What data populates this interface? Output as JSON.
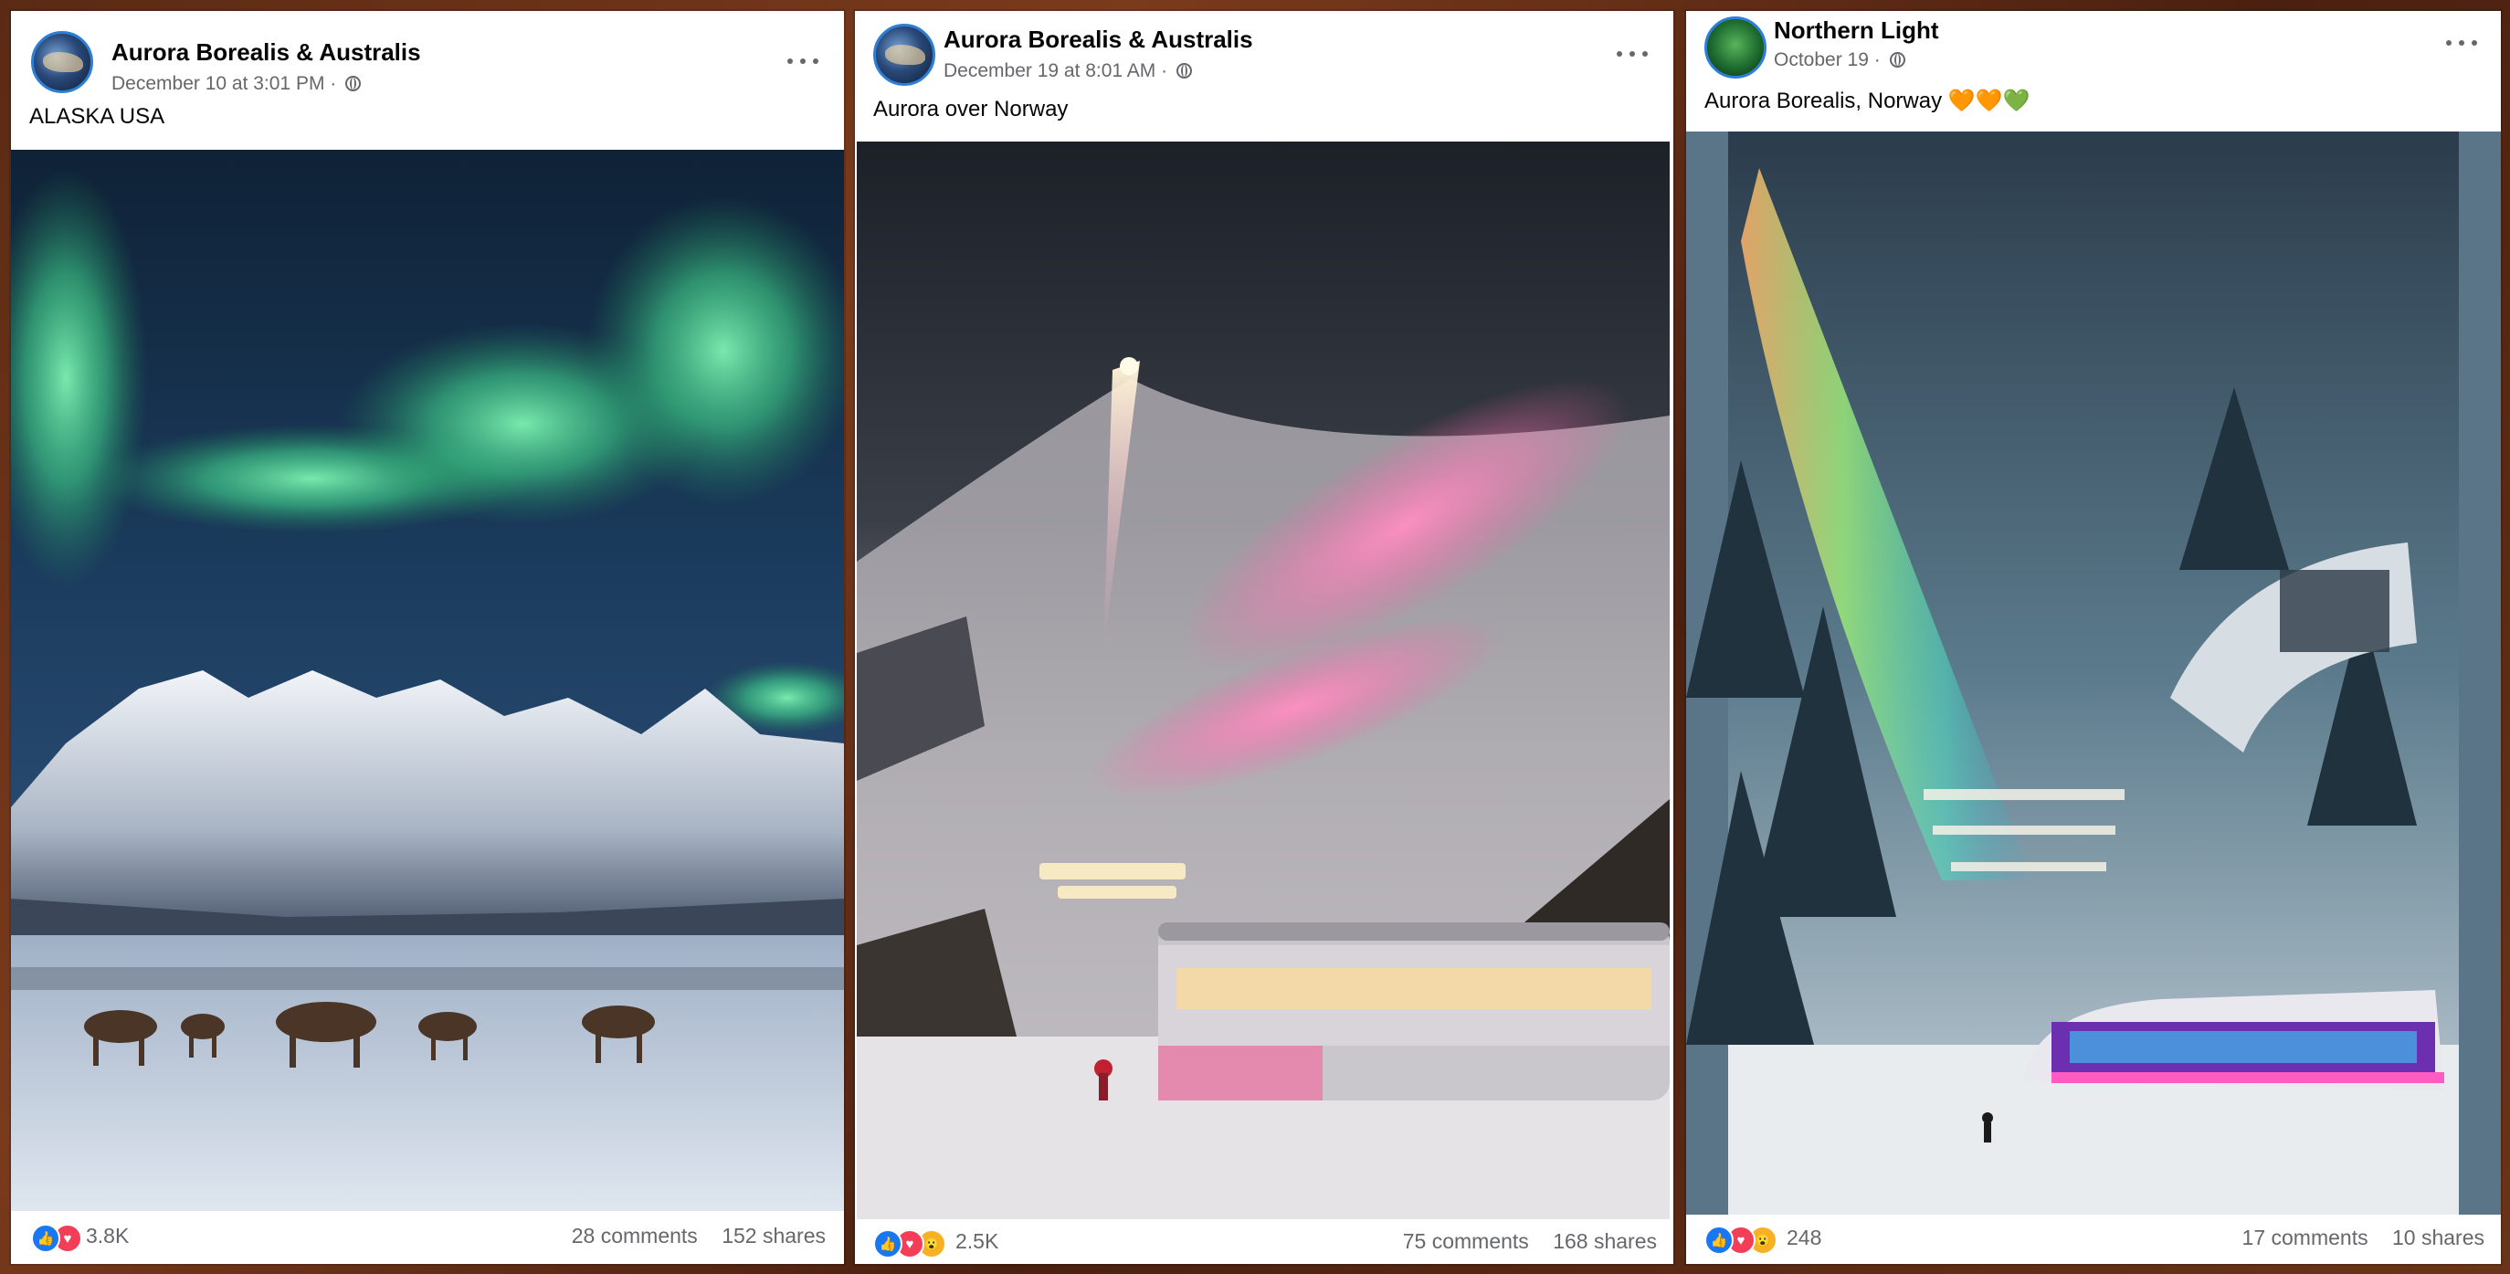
{
  "posts": [
    {
      "author": "Aurora Borealis & Australis",
      "timestamp": "December 10 at 3:01 PM",
      "separator": "·",
      "caption": "ALASKA USA",
      "reactions": [
        "like-icon",
        "love-icon"
      ],
      "reaction_count": "3.8K",
      "comments": "28 comments",
      "shares": "152 shares",
      "avatar": "aurora-avatar"
    },
    {
      "author": "Aurora Borealis & Australis",
      "timestamp": "December 19 at 8:01 AM",
      "separator": "·",
      "caption": "Aurora over Norway",
      "reactions": [
        "like-icon",
        "love-icon",
        "wow-icon"
      ],
      "reaction_count": "2.5K",
      "comments": "75 comments",
      "shares": "168 shares",
      "avatar": "aurora-avatar"
    },
    {
      "author": "Northern Light",
      "timestamp": "October 19",
      "separator": "·",
      "caption": "Aurora Borealis, Norway 🧡🧡💚",
      "reactions": [
        "like-icon",
        "love-icon",
        "wow-icon"
      ],
      "reaction_count": "248",
      "comments": "17 comments",
      "shares": "10 shares",
      "avatar": "northern-light-avatar"
    }
  ],
  "colors": {
    "like": "#1877f2",
    "love": "#f33e58",
    "wow": "#f7b125",
    "meta_text": "#65676b",
    "card_bg": "#ffffff"
  }
}
